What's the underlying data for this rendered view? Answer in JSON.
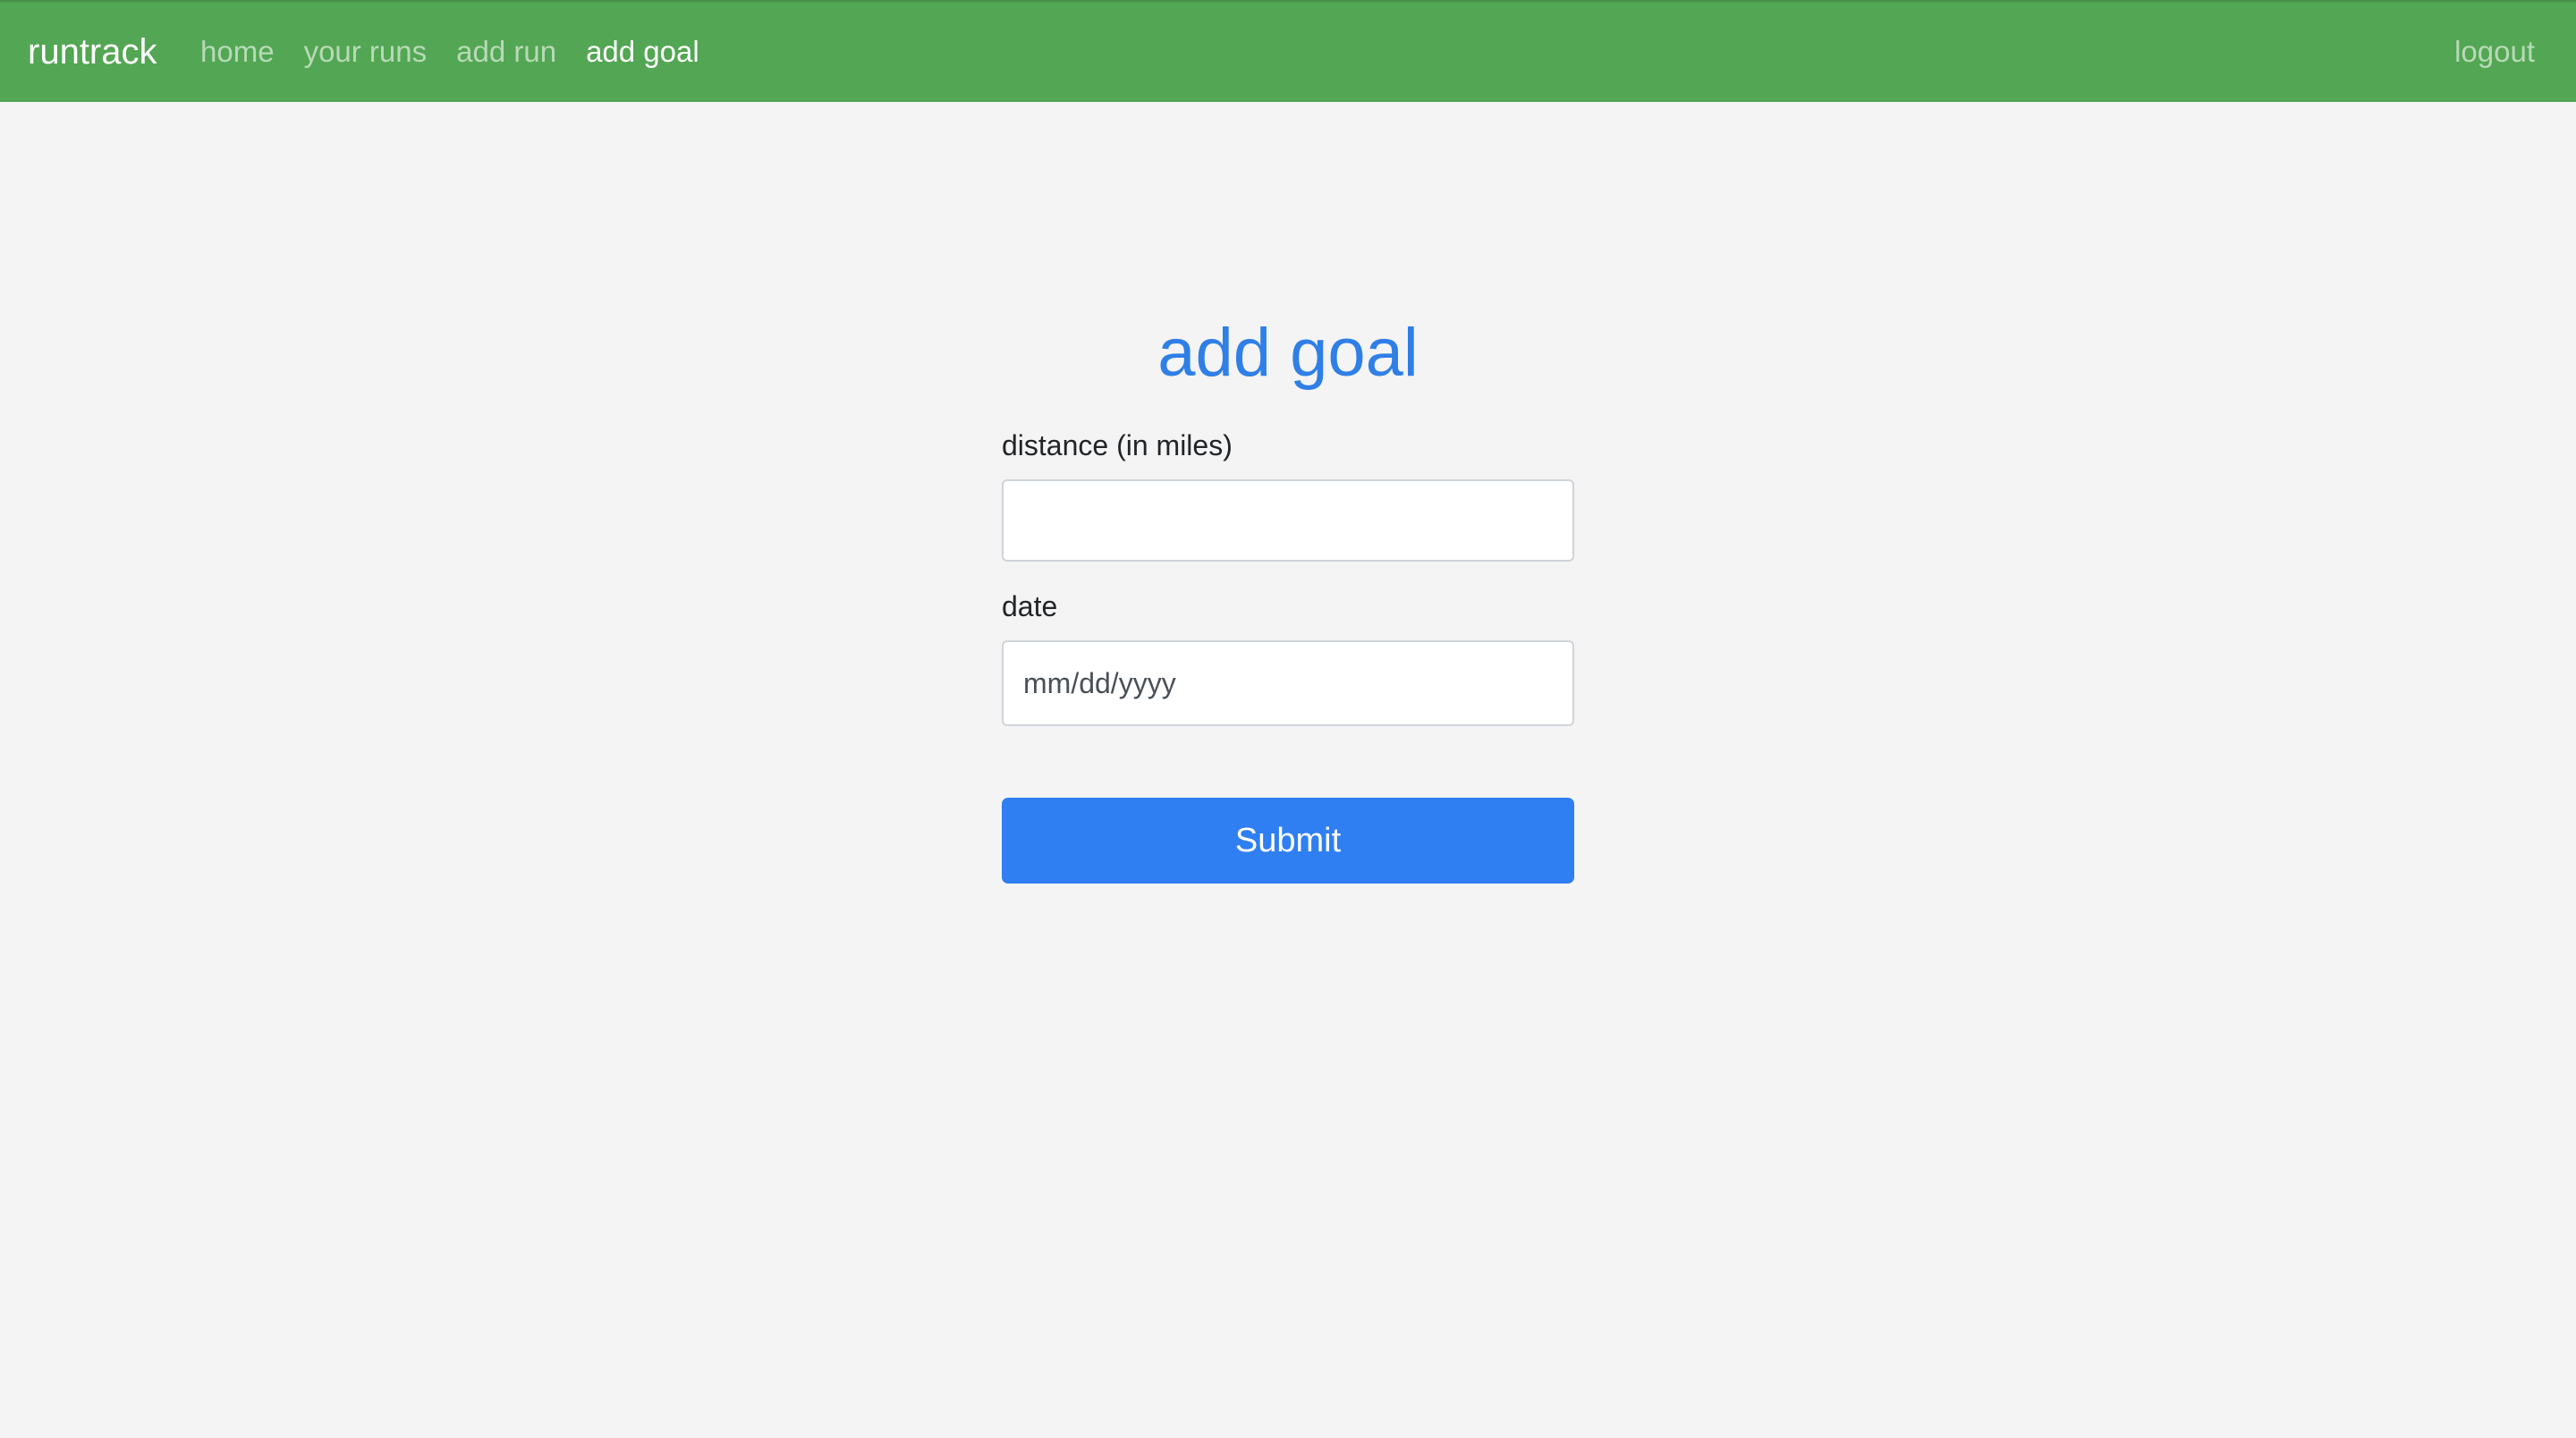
{
  "navbar": {
    "brand": "runtrack",
    "links": [
      {
        "label": "home",
        "active": false
      },
      {
        "label": "your runs",
        "active": false
      },
      {
        "label": "add run",
        "active": false
      },
      {
        "label": "add goal",
        "active": true
      }
    ],
    "logout_label": "logout"
  },
  "form": {
    "title": "add goal",
    "distance_label": "distance (in miles)",
    "distance_value": "",
    "date_label": "date",
    "date_placeholder": "mm/dd/yyyy",
    "submit_label": "Submit"
  },
  "colors": {
    "navbar_bg": "#53a653",
    "title": "#2f7fe6",
    "submit_bg": "#2f7ff2",
    "page_bg": "#f4f4f4"
  }
}
